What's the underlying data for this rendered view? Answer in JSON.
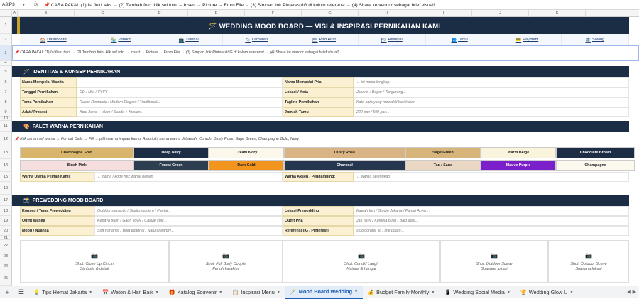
{
  "formula_bar": {
    "cell_ref": "A3:P3",
    "fx": "fx",
    "content": "📌 CARA PAKAI: (1) Isi field teks → (2) Tambah foto: klik sel foto → Insert → Picture → From File → (3) Simpan link Pinterest/IG di kolom referensi → (4) Share ke vendor sebagai brief visual!"
  },
  "columns": [
    "A",
    "B",
    "C",
    "D",
    "E",
    "F",
    "G",
    "H",
    "I",
    "J",
    "K"
  ],
  "rows": [
    "1",
    "2",
    "3",
    "4",
    "5",
    "6",
    "7",
    "8",
    "9",
    "10",
    "11",
    "12",
    "13",
    "14",
    "15",
    "16",
    "17",
    "18",
    "19",
    "20",
    "21",
    "22",
    "23",
    "24",
    "25"
  ],
  "title": "🪄 WEDDING MOOD BOARD — VISI & INSPIRASI PERNIKAHAN KAMI",
  "nav": [
    {
      "icon": "🏠",
      "label": "Dashboard"
    },
    {
      "icon": "🏪",
      "label": "Vendor"
    },
    {
      "icon": "📺",
      "label": "Tutorial"
    },
    {
      "icon": "🏷",
      "label": "Lamaran"
    },
    {
      "icon": "🗂",
      "label": "Pilih Adat"
    },
    {
      "icon": "🍽",
      "label": "Resepsi"
    },
    {
      "icon": "👥",
      "label": "Tamu"
    },
    {
      "icon": "💳",
      "label": "Payment"
    },
    {
      "icon": "🏦",
      "label": "Saving"
    }
  ],
  "instruction": "📌 CARA PAKAI: (1) Isi field teks → (2) Tambah foto: klik sel foto → Insert → Picture → From File → (3) Simpan link Pinterest/IG di kolom referensi → (4) Share ke vendor sebagai brief visual!",
  "section_identity": {
    "icon": "🪄",
    "title": "IDENTITAS & KONSEP PERNIKAHAN",
    "left": [
      {
        "label": "Nama Mempelai Wanita",
        "value": ""
      },
      {
        "label": "Tanggal Pernikahan",
        "value": "DD / MM / YYYY"
      },
      {
        "label": "Tema Pernikahan",
        "value": "Rustic Romantic / Modern Elegant / Traditional..."
      },
      {
        "label": "Adat / Prosesi",
        "value": "Adat Jawa + Islam / Sunda + Kristen..."
      }
    ],
    "right": [
      {
        "label": "Nama Mempelai Pria",
        "value": "← isi nama lengkap"
      },
      {
        "label": "Lokasi / Kota",
        "value": "Jakarta / Bogor / Tangerang..."
      },
      {
        "label": "Tagline Pernikahan",
        "value": "Kata-kata yang mewakili hari kalian"
      },
      {
        "label": "Jumlah Tamu",
        "value": "200 pax / 500 pax..."
      }
    ]
  },
  "section_palette": {
    "icon": "🎨",
    "title": "PALET WARNA PERNIKAHAN",
    "instruction": "📌 Klik kanan sel warna → Format Cells → Fill → pilih warna impian kamu. Atau tulis nama warna di bawah. Contoh: Dusty Rose, Sage Green, Champagne Gold, Navy",
    "row1": [
      {
        "name": "Champagne Gold",
        "bg": "#d8b56a",
        "fg": "#222"
      },
      {
        "name": "Deep Navy",
        "bg": "#1c2d45",
        "fg": "#fff"
      },
      {
        "name": "Cream Ivory",
        "bg": "#fbf7ea",
        "fg": "#222"
      },
      {
        "name": "Dusty Rose",
        "bg": "#d9b384",
        "fg": "#222"
      },
      {
        "name": "Sage Green",
        "bg": "#d7b47a",
        "fg": "#222"
      },
      {
        "name": "Warm Beige",
        "bg": "#fbf4dc",
        "fg": "#222"
      },
      {
        "name": "Chocolate Brown",
        "bg": "#1c2d45",
        "fg": "#fff"
      }
    ],
    "row2": [
      {
        "name": "Blush Pink",
        "bg": "#f5dedd",
        "fg": "#222"
      },
      {
        "name": "Forest Green",
        "bg": "#2c3e50",
        "fg": "#fff"
      },
      {
        "name": "Dark Gold",
        "bg": "#f2951f",
        "fg": "#222"
      },
      {
        "name": "Charcoal",
        "bg": "#26364f",
        "fg": "#fff"
      },
      {
        "name": "Tan / Sand",
        "bg": "#ead8c4",
        "fg": "#222"
      },
      {
        "name": "Mauve Purple",
        "bg": "#7a1fc9",
        "fg": "#fff"
      },
      {
        "name": "Champagne",
        "bg": "#fdf9ef",
        "fg": "#222"
      }
    ],
    "main_label": "Warna Utama Pilihan Kami:",
    "main_value": "← nama / kode hex warna pilihan",
    "accent_label": "Warna Aksen / Pendamping:",
    "accent_value": "← warna pelengkap"
  },
  "section_prewedding": {
    "icon": "📸",
    "title": "PREWEDDING MOOD BOARD",
    "left": [
      {
        "label": "Konsep / Tema Prewedding",
        "value": "Outdoor romantic / Studio modern / Pantai..."
      },
      {
        "label": "Outfit Wanita",
        "value": "Kebaya putih / Gaun flowy / Casual chic..."
      },
      {
        "label": "Mood / Nuansa",
        "value": "Soft romantic / Bold editorial / Natural earthy..."
      }
    ],
    "right": [
      {
        "label": "Lokasi Prewedding",
        "value": "Kawah Ijen / Studio Jakarta / Pantai Anyer..."
      },
      {
        "label": "Outfit Pria",
        "value": "Jas navy / Kemeja putih / Baju adat..."
      },
      {
        "label": "Referensi (IG / Pinterest)",
        "value": "@fotografer_id / link board..."
      }
    ]
  },
  "photos": [
    {
      "title": "Shot: Close Up Cincin",
      "sub": "Simbolis & detail",
      "bg": "#fbf1d2"
    },
    {
      "title": "Shot: Full Body Couple",
      "sub": "Penuh karakter",
      "bg": "#fbf1d2"
    },
    {
      "title": "Shot: Candid Laugh",
      "sub": "Natural & hangat",
      "bg": "#e8f3f8"
    },
    {
      "title": "Shot: Outdoor Scene",
      "sub": "Suasana lokasi",
      "bg": "#fdf9ef"
    },
    {
      "title": "Shot: Outdoor Scene",
      "sub": "Suasana lokasi",
      "bg": "#fdf9ef"
    }
  ],
  "tabs": [
    {
      "icon": "💡",
      "label": "Tips Hemat Jakarta",
      "active": false
    },
    {
      "icon": "📅",
      "label": "Weton & Hari Baik",
      "active": false
    },
    {
      "icon": "🎁",
      "label": "Katalog Souvenir",
      "active": false
    },
    {
      "icon": "📋",
      "label": "Inspirasi Menu",
      "active": false
    },
    {
      "icon": "🪄",
      "label": "Mood Board Wedding",
      "active": true
    },
    {
      "icon": "💰",
      "label": "Budget Family Monthly",
      "active": false
    },
    {
      "icon": "📱",
      "label": "Wedding Social Media",
      "active": false
    },
    {
      "icon": "🏆",
      "label": "Wedding Glow U",
      "active": false
    }
  ]
}
